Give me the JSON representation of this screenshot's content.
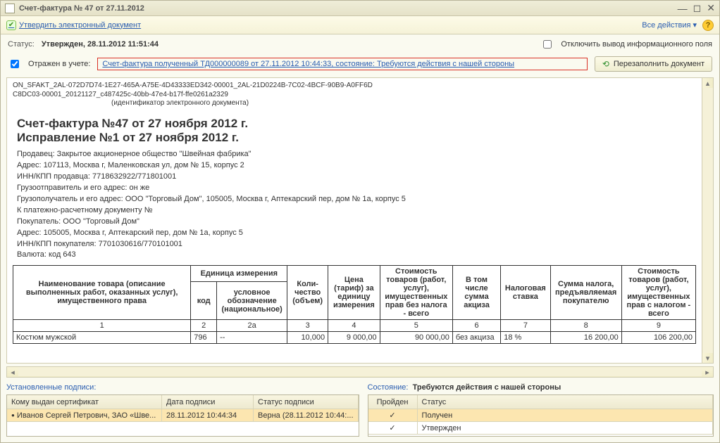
{
  "window": {
    "title": "Счет-фактура № 47 от 27.11.2012"
  },
  "toolbar": {
    "approve_label": "Утвердить электронный документ",
    "all_actions_label": "Все действия",
    "help": "?"
  },
  "status": {
    "label": "Статус:",
    "value": "Утвержден, 28.11.2012 11:51:44",
    "disable_info_label": "Отключить вывод информационного поля"
  },
  "row2": {
    "reflected_label": "Отражен в учете:",
    "link_text": "Счет-фактура полученный ТД000000089 от 27.11.2012 10:44:33, состояние: Требуются действия с нашей стороны",
    "refill_label": "Перезаполнить документ"
  },
  "doc": {
    "id_line1": "ON_SFAKT_2AL-072D7D74-1E27-465A-A75E-4D43333ED342-00001_2AL-21D0224B-7C02-4BCF-90B9-A0FF6D",
    "id_line2": "C8DC03-00001_20121127_c487425c-40bb-47e4-b17f-ffe0261a2329",
    "id_caption": "(идентификатор электронного документа)",
    "h1": "Счет-фактура №47 от 27 ноября 2012 г.",
    "h2": "Исправление №1 от 27 ноября 2012 г.",
    "seller": "Продавец: Закрытое акционерное общество \"Швейная фабрика\"",
    "seller_addr": "Адрес: 107113, Москва г, Маленковская ул, дом № 15, корпус 2",
    "seller_inn": "ИНН/КПП продавца: 7718632922/771801001",
    "shipper": "Грузоотправитель и его адрес: он же",
    "consignee": "Грузополучатель и его адрес: ООО \"Торговый Дом\", 105005, Москва г, Аптекарский пер, дом № 1а, корпус 5",
    "payment_doc": "К платежно-расчетному документу №",
    "buyer": "Покупатель: ООО \"Торговый Дом\"",
    "buyer_addr": "Адрес: 105005, Москва г, Аптекарский пер, дом № 1а, корпус 5",
    "buyer_inn": "ИНН/КПП покупателя: 7701030616/770101001",
    "currency": "Валюта: код 643",
    "headers": {
      "name": "Наименование товара (описание выполненных работ, оказанных услуг), имущественного права",
      "unit": "Единица измерения",
      "code": "код",
      "unit_name": "условное обозначение (национальное)",
      "qty": "Коли-чество (объем)",
      "price": "Цена (тариф) за единицу измерения",
      "cost_no_tax": "Стоимость товаров (работ, услуг), имущественных прав без налога - всего",
      "excise": "В том числе сумма акциза",
      "tax_rate": "Налоговая ставка",
      "tax_sum": "Сумма налога, предъявляемая покупателю",
      "cost_with_tax": "Стоимость товаров (работ, услуг), имущественных прав с налогом - всего"
    },
    "col_nums": {
      "c1": "1",
      "c2": "2",
      "c2a": "2а",
      "c3": "3",
      "c4": "4",
      "c5": "5",
      "c6": "6",
      "c7": "7",
      "c8": "8",
      "c9": "9"
    },
    "rows": [
      {
        "name": "Костюм мужской",
        "code": "796",
        "unit_name": "--",
        "qty": "10,000",
        "price": "9 000,00",
        "cost_no_tax": "90 000,00",
        "excise": "без акциза",
        "tax_rate": "18 %",
        "tax_sum": "16 200,00",
        "cost_with_tax": "106 200,00"
      }
    ]
  },
  "signatures": {
    "title": "Установленные подписи:",
    "headers": {
      "who": "Кому выдан сертификат",
      "date": "Дата подписи",
      "status": "Статус подписи"
    },
    "rows": [
      {
        "who": "Иванов Сергей Петрович, ЗАО «Шве...",
        "date": "28.11.2012 10:44:34",
        "status": "Верна (28.11.2012 10:44:..."
      }
    ]
  },
  "state": {
    "title_label": "Состояние:",
    "title_value": "Требуются действия с нашей стороны",
    "headers": {
      "passed": "Пройден",
      "status": "Статус"
    },
    "rows": [
      {
        "passed": "✓",
        "status": "Получен"
      },
      {
        "passed": "✓",
        "status": "Утвержден"
      }
    ]
  }
}
